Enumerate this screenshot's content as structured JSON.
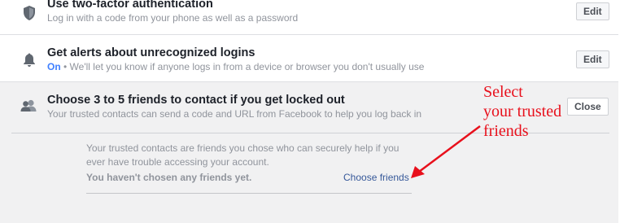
{
  "two_factor": {
    "title": "Use two-factor authentication",
    "subtitle": "Log in with a code from your phone as well as a password",
    "button": "Edit",
    "icon": "shield-icon"
  },
  "alerts": {
    "title": "Get alerts about unrecognized logins",
    "status": "On",
    "subtitle": " • We'll let you know if anyone logs in from a device or browser you don't usually use",
    "button": "Edit",
    "icon": "bell-icon"
  },
  "trusted_contacts": {
    "title": "Choose 3 to 5 friends to contact if you get locked out",
    "subtitle": "Your trusted contacts can send a code and URL from Facebook to help you log back in",
    "button": "Close",
    "icon": "friends-icon",
    "description": "Your trusted contacts are friends you chose who can securely help if you ever have trouble accessing your account.",
    "empty_message": "You haven't chosen any friends yet.",
    "choose_link": "Choose friends"
  },
  "annotation": {
    "lines": [
      "Select",
      "your trusted",
      "friends"
    ],
    "color": "#e8101c"
  },
  "colors": {
    "link": "#365899",
    "status_on": "#4080ff",
    "expanded_bg": "#f1f1f2"
  }
}
